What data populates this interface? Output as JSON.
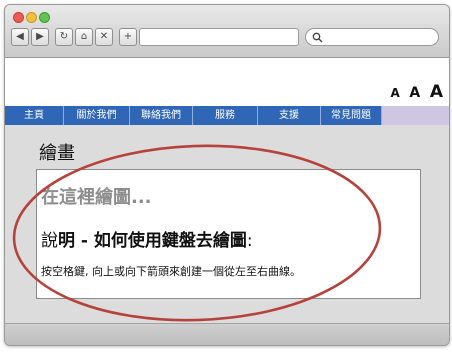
{
  "browser": {
    "back_icon": "◀",
    "forward_icon": "▶",
    "reload_icon": "↻",
    "home_icon": "⌂",
    "stop_icon": "✕",
    "add_icon": "+"
  },
  "font_controls": {
    "small": "A",
    "medium": "A",
    "large": "A"
  },
  "menu": {
    "items": [
      "主頁",
      "關於我們",
      "聯絡我們",
      "服務",
      "支援",
      "常見問題"
    ]
  },
  "page": {
    "title": "繪畫",
    "placeholder": "在這裡繪圖...",
    "explain_prefix": "說",
    "explain_bold": "明 - 如何使用鍵盤去繪圖",
    "explain_suffix": ":",
    "instructions": "按空格鍵, 向上或向下箭頭來創建一個從左至右曲線。"
  },
  "colors": {
    "menu_bg": "#2f67b6",
    "annotation": "#b5433c"
  }
}
